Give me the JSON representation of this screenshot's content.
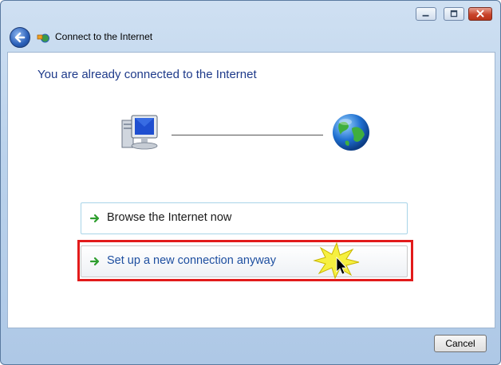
{
  "window": {
    "title": "Connect to the Internet",
    "caption_buttons": {
      "minimize": "minimize-icon",
      "maximize": "maximize-icon",
      "close": "close-icon"
    }
  },
  "nav": {
    "back_icon": "back-arrow-icon",
    "title": "Connect to the Internet"
  },
  "main": {
    "heading": "You are already connected to the Internet",
    "diagram": {
      "left_icon": "computer-icon",
      "right_icon": "globe-icon"
    },
    "options": [
      {
        "label": "Browse the Internet now",
        "icon": "green-arrow-icon"
      },
      {
        "label": "Set up a new connection anyway",
        "icon": "green-arrow-icon"
      }
    ],
    "highlight_color": "#e21b1b"
  },
  "footer": {
    "cancel_label": "Cancel"
  },
  "colors": {
    "heading": "#1e3a8a",
    "accent": "#1e4fa0",
    "arrow": "#2e9e2e"
  }
}
